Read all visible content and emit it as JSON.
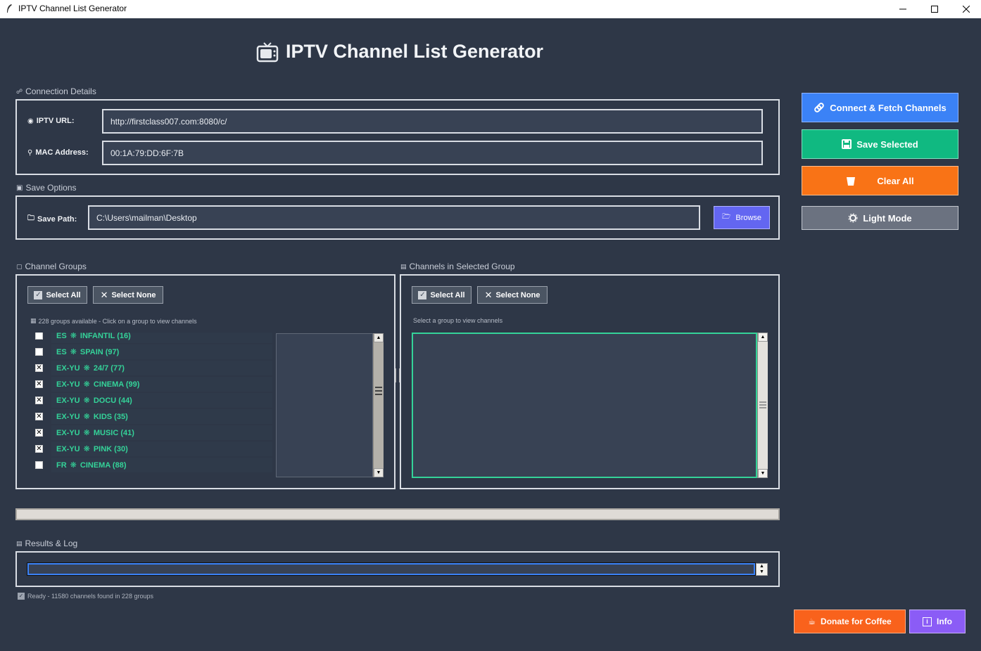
{
  "window": {
    "title": "IPTV Channel List Generator"
  },
  "header": {
    "title": "IPTV Channel List Generator",
    "icon": "tv-icon"
  },
  "connection": {
    "section_label": "Connection Details",
    "url_label": "IPTV URL:",
    "url_value": "http://firstclass007.com:8080/c/",
    "mac_label": "MAC Address:",
    "mac_value": "00:1A:79:DD:6F:7B"
  },
  "save_options": {
    "section_label": "Save Options",
    "path_label": "Save Path:",
    "path_value": "C:\\Users\\mailman\\Desktop",
    "browse_label": "Browse"
  },
  "actions": {
    "connect_label": "Connect & Fetch Channels",
    "save_label": "Save Selected",
    "clear_label": "Clear All",
    "theme_label": "Light Mode"
  },
  "groups": {
    "section_label": "Channel Groups",
    "select_all_label": "Select All",
    "select_none_label": "Select None",
    "info_text": "228 groups available - Click on a group to view channels",
    "items": [
      {
        "prefix": "ES",
        "name": "INFANTIL (16)",
        "checked": false
      },
      {
        "prefix": "ES",
        "name": "SPAIN (97)",
        "checked": false
      },
      {
        "prefix": "EX-YU",
        "name": "24/7 (77)",
        "checked": true
      },
      {
        "prefix": "EX-YU",
        "name": "CINEMA (99)",
        "checked": true
      },
      {
        "prefix": "EX-YU",
        "name": "DOCU (44)",
        "checked": true
      },
      {
        "prefix": "EX-YU",
        "name": "KIDS (35)",
        "checked": true
      },
      {
        "prefix": "EX-YU",
        "name": "MUSIC (41)",
        "checked": true
      },
      {
        "prefix": "EX-YU",
        "name": "PINK (30)",
        "checked": true
      },
      {
        "prefix": "FR",
        "name": "CINEMA (88)",
        "checked": false
      }
    ]
  },
  "channels": {
    "section_label": "Channels in Selected Group",
    "select_all_label": "Select All",
    "select_none_label": "Select None",
    "info_text": "Select a group to view channels"
  },
  "log": {
    "section_label": "Results & Log"
  },
  "status": {
    "text": "Ready - 11580 channels found in 228 groups"
  },
  "footer": {
    "donate_label": "Donate for Coffee",
    "info_label": "Info"
  },
  "colors": {
    "background": "#2e3747",
    "accent_blue": "#3b82f6",
    "accent_green": "#10b981",
    "accent_orange": "#f97316",
    "accent_indigo": "#6366f1",
    "accent_purple": "#8b5cf6",
    "group_text": "#34d399"
  }
}
